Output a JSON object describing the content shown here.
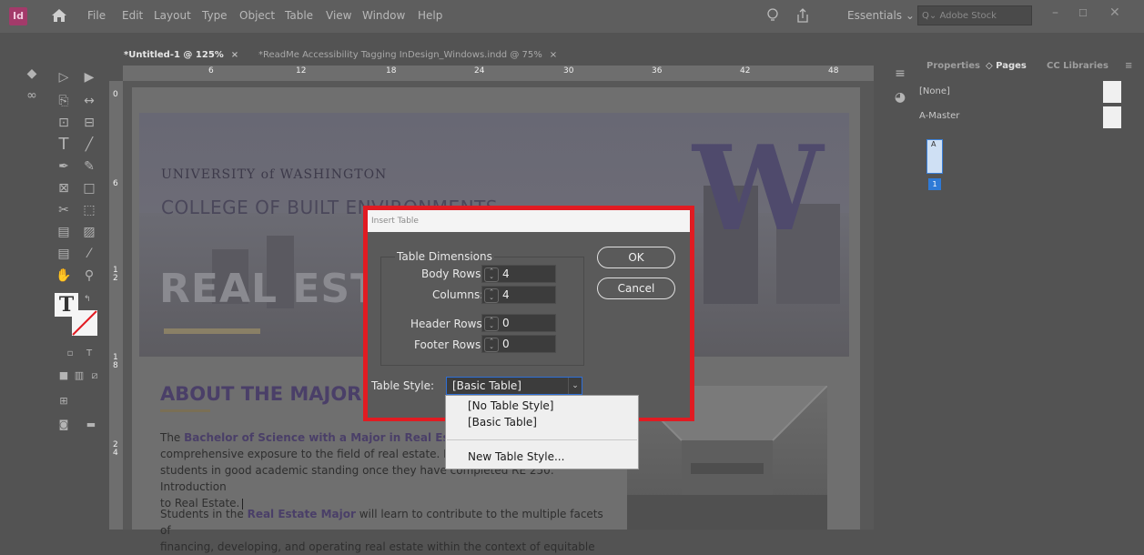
{
  "app": {
    "logo": "Id",
    "home_icon": "home-icon"
  },
  "menu": [
    "File",
    "Edit",
    "Layout",
    "Type",
    "Object",
    "Table",
    "View",
    "Window",
    "Help"
  ],
  "topright": {
    "workspace": "Essentials",
    "search_placeholder": "Adobe Stock"
  },
  "doc_tabs": [
    {
      "label": "*Untitled-1 @ 125%",
      "close": "×"
    },
    {
      "label": "*ReadMe Accessibility Tagging InDesign_Windows.indd @ 75%",
      "close": "×"
    }
  ],
  "ruler": {
    "top": [
      "6",
      "12",
      "18",
      "24",
      "30",
      "36",
      "42",
      "48"
    ],
    "left": [
      "0",
      "6",
      "1\n2",
      "1\n8",
      "2\n4"
    ]
  },
  "document": {
    "uw": "UNIVERSITY of WASHINGTON",
    "college": "COLLEGE OF BUILT ENVIRONMENTS",
    "program": "REAL ESTATE",
    "big_letter": "W",
    "heading": "ABOUT THE MAJOR",
    "p1_a": "The ",
    "p1_b": "Bachelor of Science with a Major in Real Estate",
    "p1_c": " p",
    "p1_line2": "comprehensive exposure to the field of real estate. It is",
    "p1_line3": "students in good academic standing once they have completed RE 250: Introduction",
    "p1_line4": "to Real Estate.",
    "p2_a": "Students in the ",
    "p2_b": "Real Estate Major",
    "p2_c": " will learn to contribute to the multiple facets of",
    "p2_line2": "financing, developing, and operating real estate within the context of equitable"
  },
  "panel": {
    "tabs": [
      "Properties",
      "◇ Pages",
      "CC Libraries"
    ],
    "items": [
      "[None]",
      "A-Master"
    ],
    "page_master_badge": "A",
    "page_number": "1"
  },
  "dialog": {
    "title": "Insert Table",
    "group_label": "Table Dimensions",
    "body_rows_label": "Body Rows:",
    "body_rows": "4",
    "columns_label": "Columns:",
    "columns": "4",
    "header_rows_label": "Header Rows:",
    "header_rows": "0",
    "footer_rows_label": "Footer Rows:",
    "footer_rows": "0",
    "ok": "OK",
    "cancel": "Cancel",
    "style_label": "Table Style:",
    "style_value": "[Basic Table]",
    "options": [
      "[No Table Style]",
      "[Basic Table]",
      "New Table Style..."
    ]
  },
  "colors": {
    "highlight_border": "#e11b22",
    "uw_purple": "#4a3f68",
    "logo_bg": "#a33a6a"
  }
}
